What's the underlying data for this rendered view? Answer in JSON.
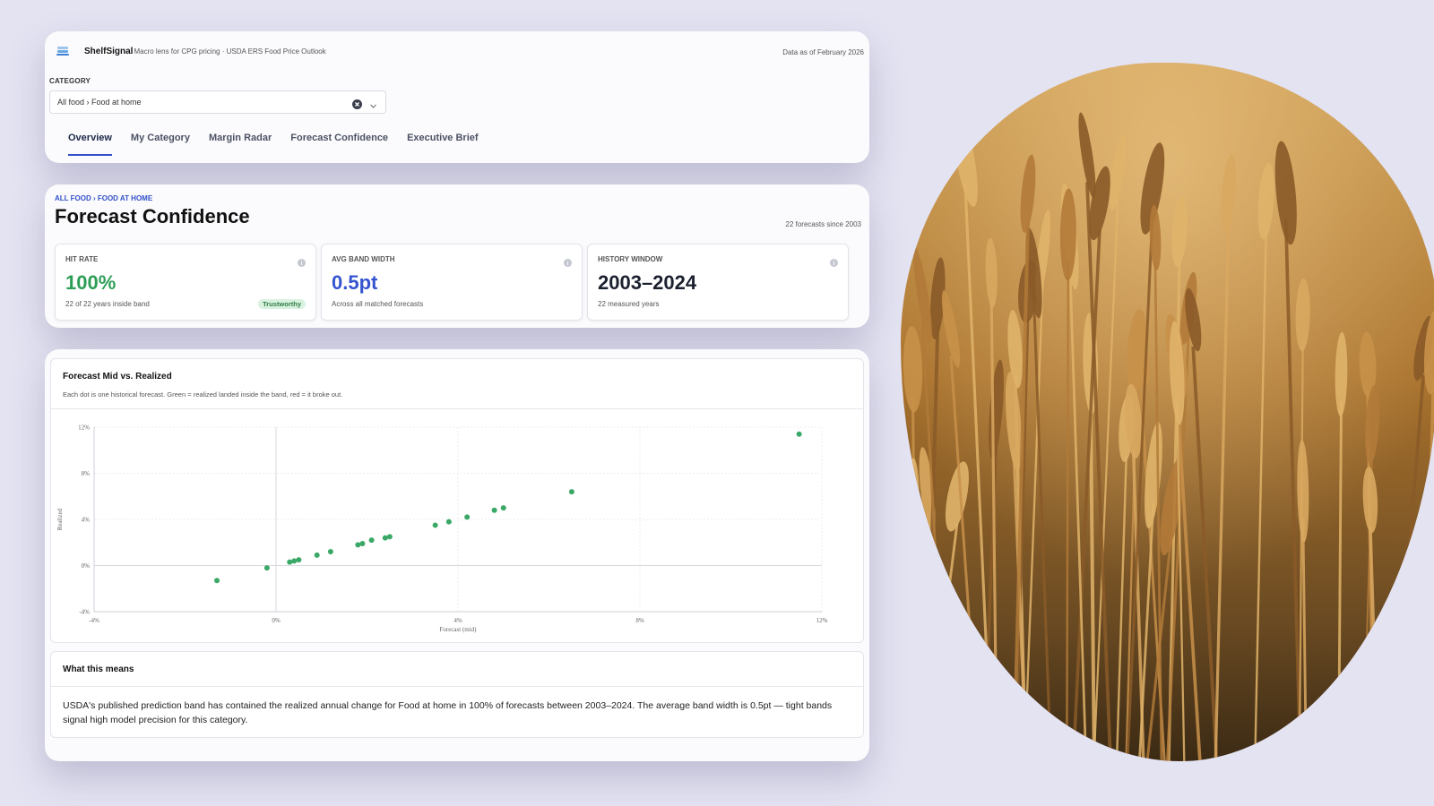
{
  "app": {
    "brand": "ShelfSignal",
    "tagline": "Macro lens for CPG pricing · USDA ERS Food Price Outlook",
    "as_of": "Data as of February 2026"
  },
  "filter": {
    "label": "CATEGORY",
    "value": "All food › Food at home"
  },
  "tabs": [
    "Overview",
    "My Category",
    "Margin Radar",
    "Forecast Confidence",
    "Executive Brief"
  ],
  "active_tab": "Overview",
  "page": {
    "breadcrumb": "ALL FOOD › FOOD AT HOME",
    "title": "Forecast Confidence",
    "forecast_count": "22 forecasts since 2003"
  },
  "kpis": [
    {
      "label": "HIT RATE",
      "value": "100%",
      "sub": "22 of 22 years inside band",
      "badge": "Trustworthy",
      "color": "#2e9e57"
    },
    {
      "label": "AVG BAND WIDTH",
      "value": "0.5pt",
      "sub": "Across all matched forecasts",
      "color": "#3554cf"
    },
    {
      "label": "HISTORY WINDOW",
      "value": "2003–2024",
      "sub": "22 measured years",
      "color": "#1c2130"
    }
  ],
  "chart_card": {
    "title": "Forecast Mid vs. Realized",
    "subtitle": "Each dot is one historical forecast. Green = realized landed inside the band, red = it broke out."
  },
  "chart_data": {
    "type": "scatter",
    "xlabel": "Forecast (mid)",
    "ylabel": "Realized",
    "xlim": [
      -4,
      12
    ],
    "ylim": [
      -4,
      12
    ],
    "xticks": [
      "-4%",
      "0%",
      "4%",
      "8%",
      "12%"
    ],
    "yticks": [
      "-4%",
      "0%",
      "4%",
      "8%",
      "12%"
    ],
    "grid": true,
    "point_color": "#3aa866",
    "points": [
      {
        "x": -1.3,
        "y": -1.3
      },
      {
        "x": -0.2,
        "y": -0.2
      },
      {
        "x": 0.3,
        "y": 0.3
      },
      {
        "x": 0.4,
        "y": 0.4
      },
      {
        "x": 0.5,
        "y": 0.5
      },
      {
        "x": 0.9,
        "y": 0.9
      },
      {
        "x": 1.2,
        "y": 1.2
      },
      {
        "x": 1.8,
        "y": 1.8
      },
      {
        "x": 1.9,
        "y": 1.9
      },
      {
        "x": 2.1,
        "y": 2.2
      },
      {
        "x": 2.4,
        "y": 2.4
      },
      {
        "x": 2.5,
        "y": 2.5
      },
      {
        "x": 3.5,
        "y": 3.5
      },
      {
        "x": 3.8,
        "y": 3.8
      },
      {
        "x": 4.2,
        "y": 4.2
      },
      {
        "x": 4.8,
        "y": 4.8
      },
      {
        "x": 5.0,
        "y": 5.0
      },
      {
        "x": 6.5,
        "y": 6.4
      },
      {
        "x": 11.5,
        "y": 11.4
      }
    ]
  },
  "meaning": {
    "title": "What this means",
    "body": "USDA's published prediction band has contained the realized annual change for Food at home in 100% of forecasts between 2003–2024. The average band width is 0.5pt — tight bands signal high model precision for this category."
  },
  "icons": {
    "logo": "shelf-icon",
    "clear": "clear-icon",
    "dropdown": "chevron-down-icon",
    "info": "info-icon"
  },
  "photo": {
    "subject": "wheat field"
  }
}
